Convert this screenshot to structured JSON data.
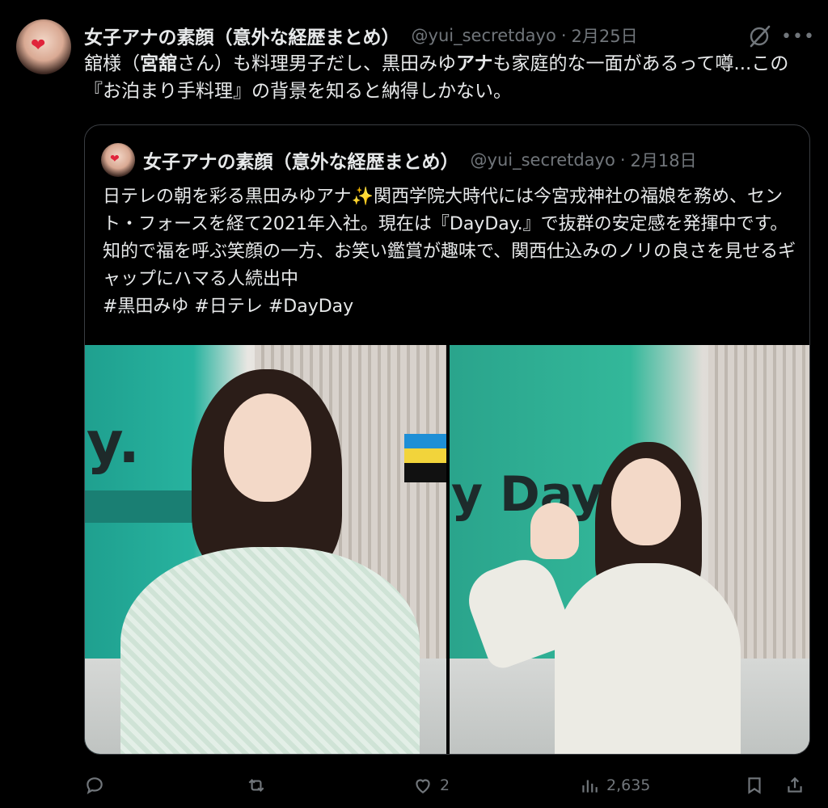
{
  "post": {
    "author_name": "女子アナの素顔（意外な経歴まとめ）",
    "handle": "@yui_secretdayo",
    "separator": "·",
    "date": "2月25日",
    "text_part1": "舘様（",
    "text_bold1": "宮舘",
    "text_part2": "さん）も料理男子だし、黒田みゆ",
    "text_bold2": "アナ",
    "text_part3": "も家庭的な一面があるって噂...この『お泊まり手料理』の背景を知ると納得しかない。"
  },
  "quoted_post": {
    "author_name": "女子アナの素顔（意外な経歴まとめ）",
    "handle": "@yui_secretdayo",
    "separator": "·",
    "date": "2月18日",
    "text": "日テレの朝を彩る黒田みゆアナ✨関西学院大時代には今宮戎神社の福娘を務め、セント・フォースを経て2021年入社。現在は『DayDay.』で抜群の安定感を発揮中です。知的で福を呼ぶ笑顔の一方、お笑い鑑賞が趣味で、関西仕込みのノリの良さを見せるギャップにハマる人続出中",
    "hashtags": "#黒田みゆ #日テレ #DayDay",
    "photo_left_set_text": "y.",
    "photo_right_set_text": "y Day."
  },
  "actions": {
    "reply_count": "",
    "repost_count": "",
    "like_count": "2",
    "views_count": "2,635"
  },
  "icons": {
    "grok": "grok-icon",
    "more": "more-icon",
    "reply": "reply-icon",
    "repost": "repost-icon",
    "like": "heart-icon",
    "views": "views-icon",
    "bookmark": "bookmark-icon",
    "share": "share-icon"
  },
  "colors": {
    "background": "#000000",
    "text": "#e7e9ea",
    "secondary": "#71767b",
    "border": "#3a3d42"
  }
}
